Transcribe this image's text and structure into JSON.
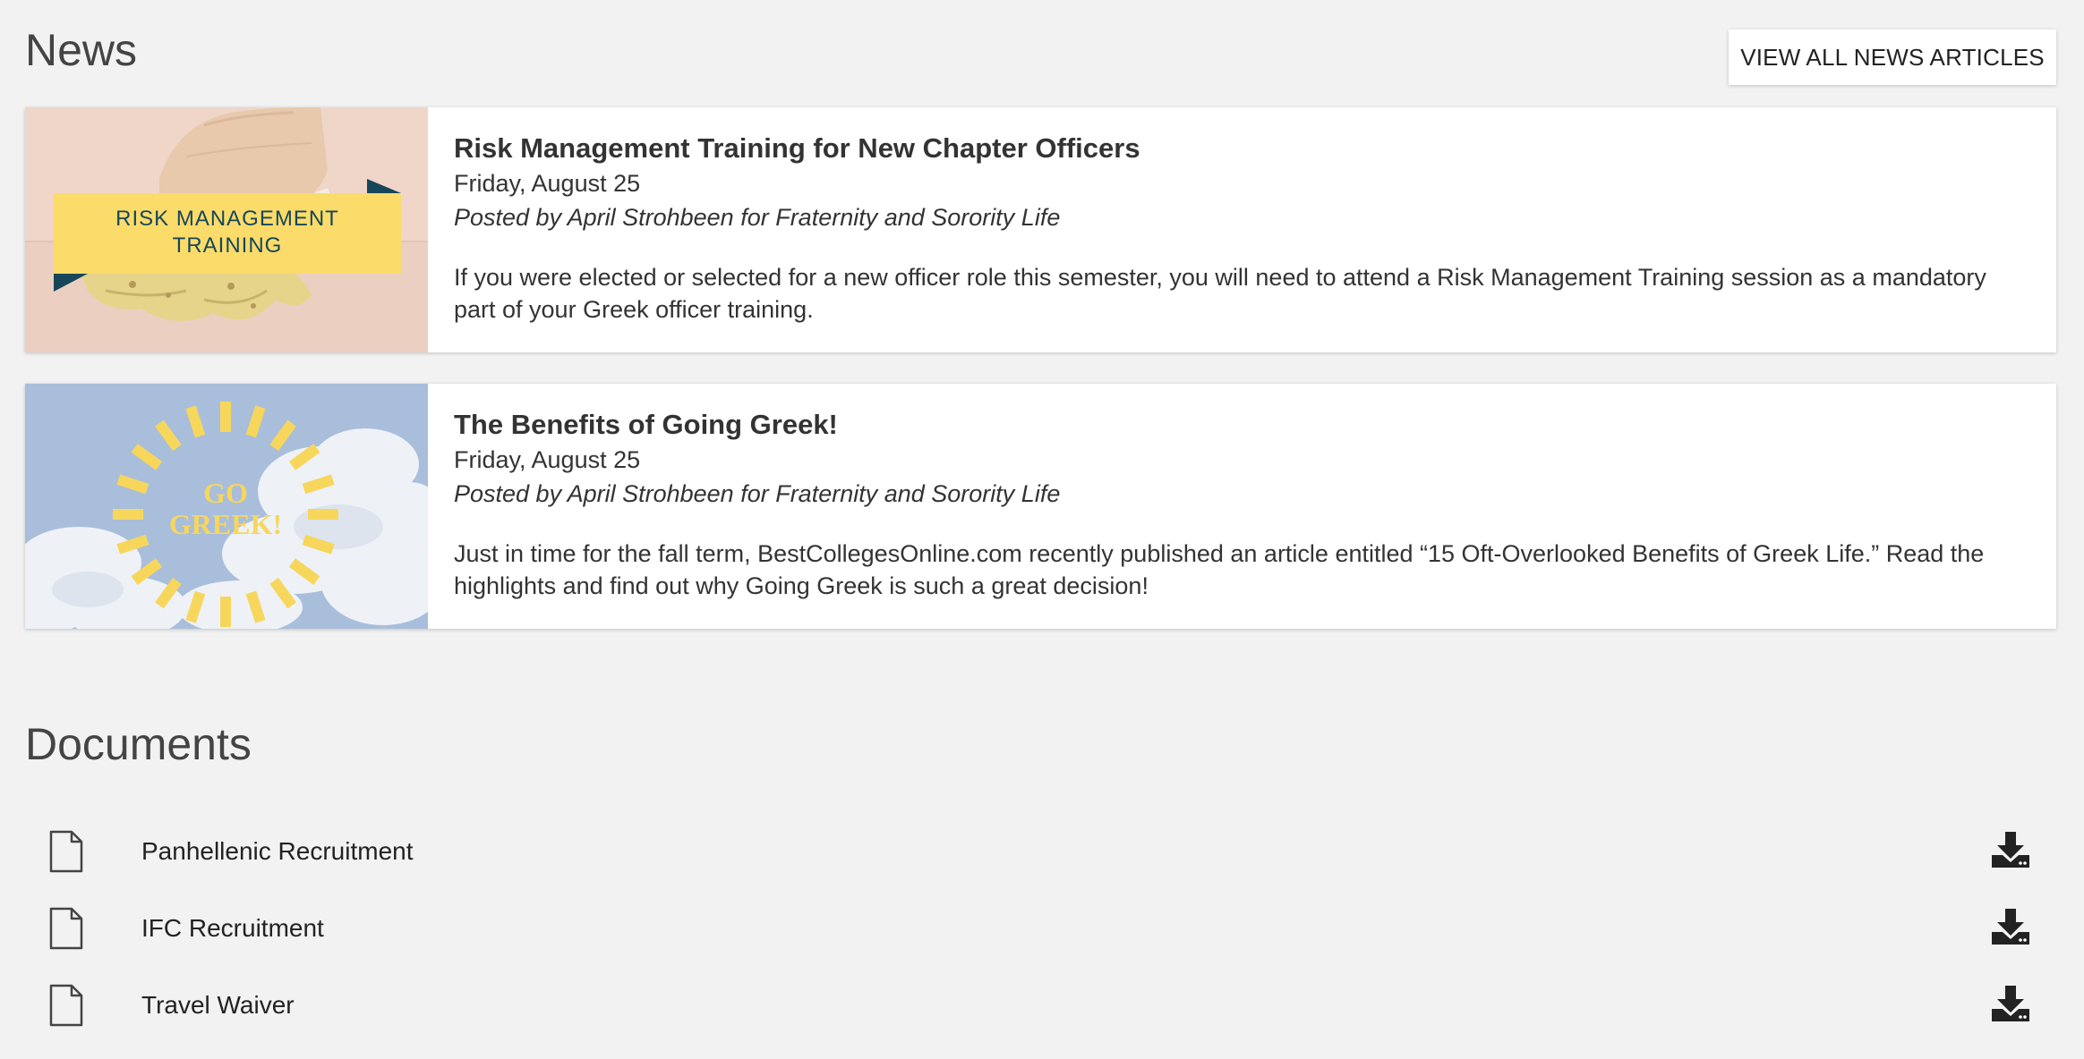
{
  "news": {
    "title": "News",
    "view_all_label": "VIEW ALL NEWS ARTICLES",
    "articles": [
      {
        "title": "Risk Management Training for New Chapter Officers",
        "date": "Friday, August 25",
        "author": "Posted by April Strohbeen for Fraternity and Sorority Life",
        "excerpt": "If you were elected or selected for a new officer role this semester, you will need to attend a Risk Management Training session as a mandatory part of your Greek officer training.",
        "thumb_line_1": "RISK MANAGEMENT",
        "thumb_line_2": "TRAINING"
      },
      {
        "title": "The Benefits of Going Greek!",
        "date": "Friday, August 25",
        "author": "Posted by April Strohbeen for Fraternity and Sorority Life",
        "excerpt": "Just in time for the fall term, BestCollegesOnline.com recently published an article entitled “15 Oft-Overlooked Benefits of Greek Life.” Read the highlights and find out why Going Greek is such a great decision!",
        "thumb_line_1": "GO",
        "thumb_line_2": "GREEK!"
      }
    ]
  },
  "documents": {
    "title": "Documents",
    "items": [
      {
        "name": "Panhellenic Recruitment"
      },
      {
        "name": "IFC Recruitment"
      },
      {
        "name": "Travel Waiver"
      }
    ]
  },
  "colors": {
    "background": "#f2f2f2",
    "card": "#ffffff",
    "banner_yellow": "#fbdc6a",
    "banner_navy": "#17465a",
    "sky_blue": "#a9bedb",
    "text": "#333333"
  }
}
